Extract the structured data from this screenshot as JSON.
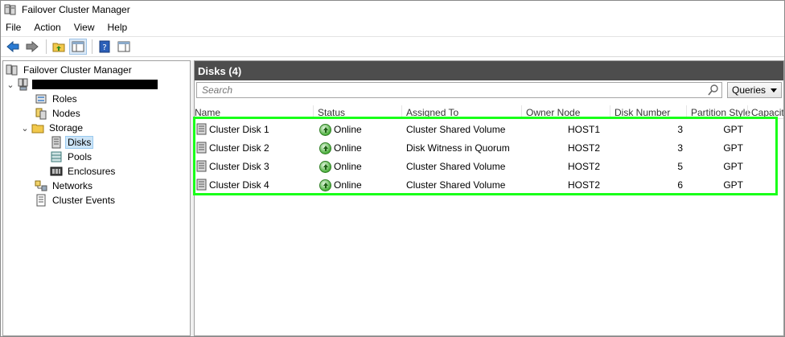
{
  "window": {
    "title": "Failover Cluster Manager"
  },
  "menu": [
    {
      "label": "File"
    },
    {
      "label": "Action"
    },
    {
      "label": "View"
    },
    {
      "label": "Help"
    }
  ],
  "tree": {
    "root": "Failover Cluster Manager",
    "cluster_name": "",
    "items": [
      {
        "label": "Roles"
      },
      {
        "label": "Nodes"
      },
      {
        "label": "Storage"
      },
      {
        "label": "Disks"
      },
      {
        "label": "Pools"
      },
      {
        "label": "Enclosures"
      },
      {
        "label": "Networks"
      },
      {
        "label": "Cluster Events"
      }
    ]
  },
  "panel": {
    "title": "Disks (4)",
    "search_placeholder": "Search",
    "queries_label": "Queries"
  },
  "columns": [
    "Name",
    "Status",
    "Assigned To",
    "Owner Node",
    "Disk Number",
    "Partition Style",
    "Capacity"
  ],
  "disks": [
    {
      "name": "Cluster Disk 1",
      "status": "Online",
      "assigned_to": "Cluster Shared Volume",
      "owner_node": "HOST1",
      "disk_number": "3",
      "partition_style": "GPT"
    },
    {
      "name": "Cluster Disk 2",
      "status": "Online",
      "assigned_to": "Disk Witness in Quorum",
      "owner_node": "HOST2",
      "disk_number": "3",
      "partition_style": "GPT"
    },
    {
      "name": "Cluster Disk 3",
      "status": "Online",
      "assigned_to": "Cluster Shared Volume",
      "owner_node": "HOST2",
      "disk_number": "5",
      "partition_style": "GPT"
    },
    {
      "name": "Cluster Disk 4",
      "status": "Online",
      "assigned_to": "Cluster Shared Volume",
      "owner_node": "HOST2",
      "disk_number": "6",
      "partition_style": "GPT"
    }
  ],
  "colors": {
    "highlight": "#19ff19",
    "header_bg": "#4d4d4d",
    "selection": "#cce4f7"
  }
}
